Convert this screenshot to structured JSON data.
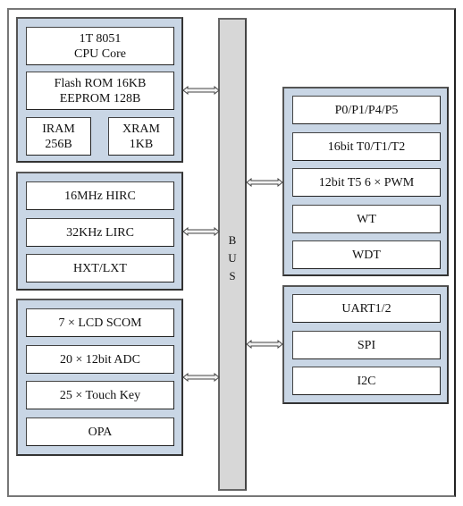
{
  "diagram": {
    "bus_label": "B\nU\nS",
    "left_groups": [
      {
        "name": "core-memory",
        "blocks": [
          {
            "label": "1T 8051\nCPU Core"
          },
          {
            "label": "Flash ROM 16KB\nEEPROM 128B"
          },
          {
            "label": "IRAM\n256B"
          },
          {
            "label": "XRAM\n1KB"
          }
        ]
      },
      {
        "name": "clock",
        "blocks": [
          {
            "label": "16MHz HIRC"
          },
          {
            "label": "32KHz LIRC"
          },
          {
            "label": "HXT/LXT"
          }
        ]
      },
      {
        "name": "analog",
        "blocks": [
          {
            "label": "7 × LCD SCOM"
          },
          {
            "label": "20 × 12bit ADC"
          },
          {
            "label": "25 × Touch Key"
          },
          {
            "label": "OPA"
          }
        ]
      }
    ],
    "right_groups": [
      {
        "name": "io-timers",
        "blocks": [
          {
            "label": "P0/P1/P4/P5"
          },
          {
            "label": "16bit  T0/T1/T2"
          },
          {
            "label": "12bit T5  6 × PWM"
          },
          {
            "label": "WT"
          },
          {
            "label": "WDT"
          }
        ]
      },
      {
        "name": "communication",
        "blocks": [
          {
            "label": "UART1/2"
          },
          {
            "label": "SPI"
          },
          {
            "label": "I2C"
          }
        ]
      }
    ],
    "colors": {
      "panel_fill": "#c9d6e5",
      "bus_fill": "#d7d7d7",
      "block_fill": "#ffffff"
    }
  }
}
